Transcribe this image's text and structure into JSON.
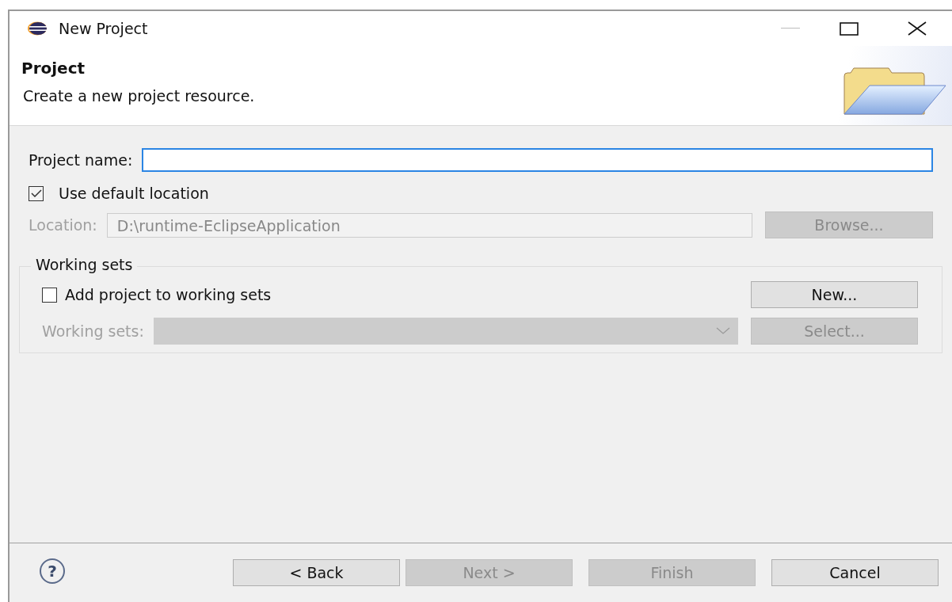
{
  "window": {
    "title": "New Project"
  },
  "header": {
    "title": "Project",
    "description": "Create a new project resource."
  },
  "project_name": {
    "label": "Project name:",
    "focused": true
  },
  "use_default_location": {
    "label": "Use default location",
    "checked": true
  },
  "location": {
    "label": "Location:",
    "value": "D:\\runtime-EclipseApplication",
    "disabled": true
  },
  "browse_button": {
    "label": "Browse...",
    "disabled": true
  },
  "working_sets_group": {
    "title": "Working sets",
    "add_checkbox": {
      "label": "Add project to working sets",
      "checked": false
    },
    "new_button": {
      "label": "New...",
      "disabled": false
    },
    "combo": {
      "label": "Working sets:",
      "disabled": true
    },
    "select_button": {
      "label": "Select...",
      "disabled": true
    }
  },
  "footer": {
    "help": "?",
    "buttons": [
      {
        "label": "< Back",
        "disabled": false
      },
      {
        "label": "Next >",
        "disabled": true
      },
      {
        "label": "Finish",
        "disabled": true
      },
      {
        "label": "Cancel",
        "disabled": false
      }
    ]
  }
}
